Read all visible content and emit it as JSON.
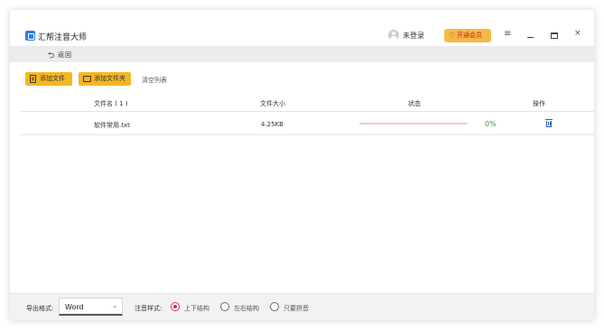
{
  "app": {
    "title": "汇帮注音大师",
    "login_text": "未登录",
    "vip_label": "开通会员",
    "menu_glyph": "≡",
    "close_glyph": "×"
  },
  "nav": {
    "back_glyph": "⮌",
    "back_label": "返回"
  },
  "toolbar": {
    "add_file": "添加文件",
    "add_folder": "添加文件夹",
    "clear_list": "清空列表"
  },
  "table": {
    "headers": {
      "filename": "文件名 ( 1 )",
      "filesize": "文件大小",
      "status": "状态",
      "action": "操作"
    },
    "rows": [
      {
        "filename": "软件常用.txt",
        "filesize": "4.25KB",
        "progress_percent": 0,
        "progress_label": "0%"
      }
    ]
  },
  "bottom": {
    "export_label": "导出格式:",
    "export_value": "Word",
    "style_label": "注音样式:",
    "styles": [
      {
        "label": "上下结构",
        "checked": true
      },
      {
        "label": "左右结构",
        "checked": false
      },
      {
        "label": "只要拼音",
        "checked": false
      }
    ]
  },
  "colors": {
    "accent_yellow": "#f5b623",
    "progress_pink": "#f3c8d4",
    "percent_green": "#2ea043",
    "radio_magenta": "#d4286c",
    "logo_blue": "#2f7de1"
  }
}
